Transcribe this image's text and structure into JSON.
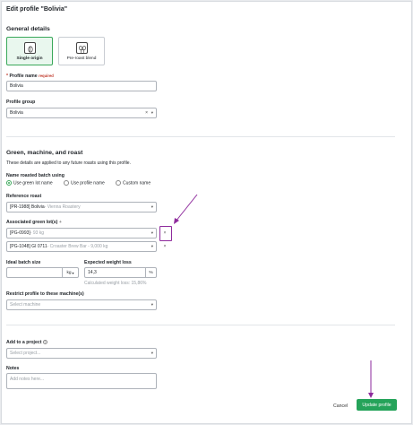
{
  "title": "Edit profile \"Bolivia\"",
  "general": {
    "heading": "General details",
    "options": [
      {
        "label": "Single origin",
        "selected": true
      },
      {
        "label": "Pre-roast blend",
        "selected": false
      }
    ],
    "profile_name_star": "*",
    "profile_name_label": "Profile name",
    "profile_name_required": "required",
    "profile_name_value": "Bolivia",
    "profile_group_label": "Profile group",
    "profile_group_value": "Bolivia",
    "clear_glyph": "×",
    "chevron_glyph": "▾"
  },
  "green": {
    "heading": "Green, machine, and roast",
    "subtext": "These details are applied to any future roasts using this profile.",
    "batch_name_label": "Name roasted batch using",
    "batch_name_options": [
      {
        "label": "Use green lot name",
        "selected": true
      },
      {
        "label": "Use profile name",
        "selected": false
      },
      {
        "label": "Custom name",
        "selected": false
      }
    ],
    "reference_roast_label": "Reference roast",
    "reference_roast_code": "[PR-1988] Bolivia",
    "reference_roast_detail": " - Vienna Roastery",
    "green_lots_label": "Associated green lot(s)",
    "green_lots_add": "+",
    "green_lots": [
      {
        "code": "[PG-0993]",
        "detail": " - 93 kg"
      },
      {
        "code": "[PG-1048] GI 0711",
        "detail": " - Croaster Brew Bar - 9,000 kg"
      }
    ],
    "remove_glyph": "×",
    "batch_size_label": "Ideal batch size",
    "batch_size_value": "",
    "batch_size_unit": "kg",
    "weight_loss_label": "Expected weight loss",
    "weight_loss_value": "14,3",
    "weight_loss_unit": "%",
    "weight_loss_calc": "Calculated weight loss: 15,86%",
    "machine_label": "Restrict profile to these machine(s)",
    "machine_placeholder": "Select machine"
  },
  "project": {
    "label": "Add to a project",
    "help_glyph": "?",
    "placeholder": "Select project..."
  },
  "notes": {
    "label": "Notes",
    "placeholder": "Add notes here..."
  },
  "actions": {
    "cancel": "Cancel",
    "update": "Update profile"
  },
  "colors": {
    "accent_green": "#25a35a",
    "selected_card_bg": "#e9f7ee",
    "annotation": "#8e2a9c"
  }
}
